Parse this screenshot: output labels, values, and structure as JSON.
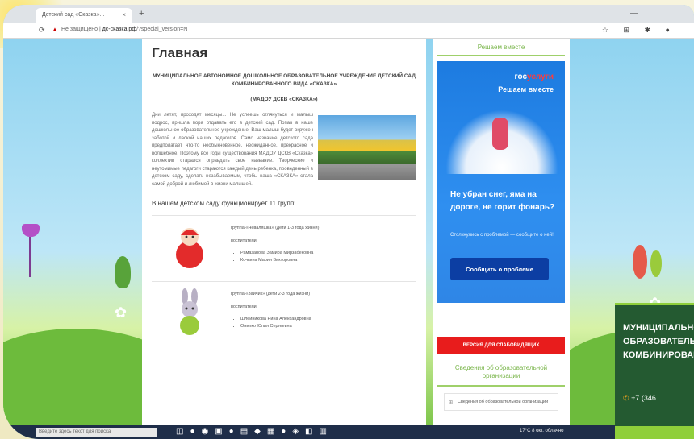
{
  "browser": {
    "tab_title": "Детский сад «Сказка»...",
    "tab_close": "×",
    "new_tab": "+",
    "window_controls": "—",
    "reload_icon": "reload-icon",
    "security_warning": "Не защищено",
    "url_domain": "дс-сказка.рф",
    "url_path": "/?special_version=N",
    "toolbar_icons": "☆ ⊞ ✱ ●"
  },
  "main": {
    "page_title": "Главная",
    "org_title": "МУНИЦИПАЛЬНОЕ АВТОНОМНОЕ ДОШКОЛЬНОЕ ОБРАЗОВАТЕЛЬНОЕ УЧРЕЖДЕНИЕ ДЕТСКИЙ САД КОМБИНИРОВАННОГО ВИДА «СКАЗКА»",
    "org_short": "(МАДОУ ДСКВ «СКАЗКА»)",
    "intro_text": "Дни летят, проходят месяцы... Не успеешь оглянуться и малыш подрос, пришла пора отдавать его в детский сад. Попав в наше дошкольное образовательное учреждение, Ваш малыш будет окружен заботой и лаской наших педагогов. Само название детского сада предполагает что-то необыкновенное, неожиданное, прекрасное и волшебное. Поэтому все годы существования МАДОУ ДСКВ «Сказка» коллектив старался оправдать свое название. Творческие и неутомимые педагоги стараются каждый день ребенка, проведенный в детском саду, сделать незабываемым, чтобы наша «СКАЗКА» стала самой доброй и любимой в жизни малышей.",
    "groups_heading": "В нашем детском саду функционирует 11 групп:",
    "groups": [
      {
        "name": "группа «Неваляшка» (дети 1-3 года жизни)",
        "teachers_label": "воспитатели:",
        "teachers": [
          "Рамазанова Замира Мирзабековна",
          "Кочкина Мария Викторовна"
        ]
      },
      {
        "name": "группа «Зайчик» (дети 2-3 года жизни)",
        "teachers_label": "воспитатели:",
        "teachers": [
          "Шлейникова Нина Александровна",
          "Онипко Юлия Сергеевна"
        ]
      }
    ]
  },
  "sidebar": {
    "together_heading": "Решаем вместе",
    "gos_logo_part1": "гос",
    "gos_logo_part2": "услуги",
    "gos_slogan": "Решаем вместе",
    "gos_headline": "Не убран снег, яма на дороге, не горит фонарь?",
    "gos_sub": "Столкнулись с проблемой — сообщите о ней!",
    "report_button": "Сообщить о проблеме",
    "vision_button": "ВЕРСИЯ ДЛЯ СЛАБОВИДЯЩИХ",
    "info_heading": "Сведения об образовательной организации",
    "info_link": "Сведения об образовательной организации"
  },
  "taskbar": {
    "search_placeholder": "Введите здесь текст для поиска",
    "weather": "17°С 8 окт. облачно"
  },
  "overlay": {
    "text": "МУНИЦИПАЛЬНОЕ ОБРАЗОВАТЕЛЬНОЕ КОМБИНИРОВАННОГО",
    "phone": "+7 (346"
  }
}
